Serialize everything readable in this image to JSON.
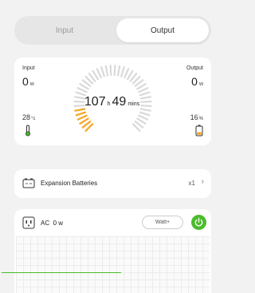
{
  "tabs": {
    "input": "Input",
    "output": "Output",
    "active": "output"
  },
  "main": {
    "input_label": "Input",
    "input_value": "0",
    "input_unit": "w",
    "output_label": "Output",
    "output_value": "0",
    "output_unit": "w",
    "temp_value": "28",
    "temp_unit": "°c",
    "battery_value": "16",
    "battery_unit": "%",
    "time_hours": "107",
    "time_h_unit": "h",
    "time_minutes": "49",
    "time_min_unit": "mins",
    "gauge_fill_fraction": 0.16,
    "colors": {
      "fill": "#f5a623",
      "track": "#d9d9d9",
      "thermometer": "#4cbb2b",
      "battery": "#f5a623"
    }
  },
  "expansion": {
    "label": "Expansion Batteries",
    "count": "x1"
  },
  "ac": {
    "label": "AC",
    "value": "0 w",
    "watt_button": "Watt+",
    "power_color": "#4cbb2b"
  }
}
